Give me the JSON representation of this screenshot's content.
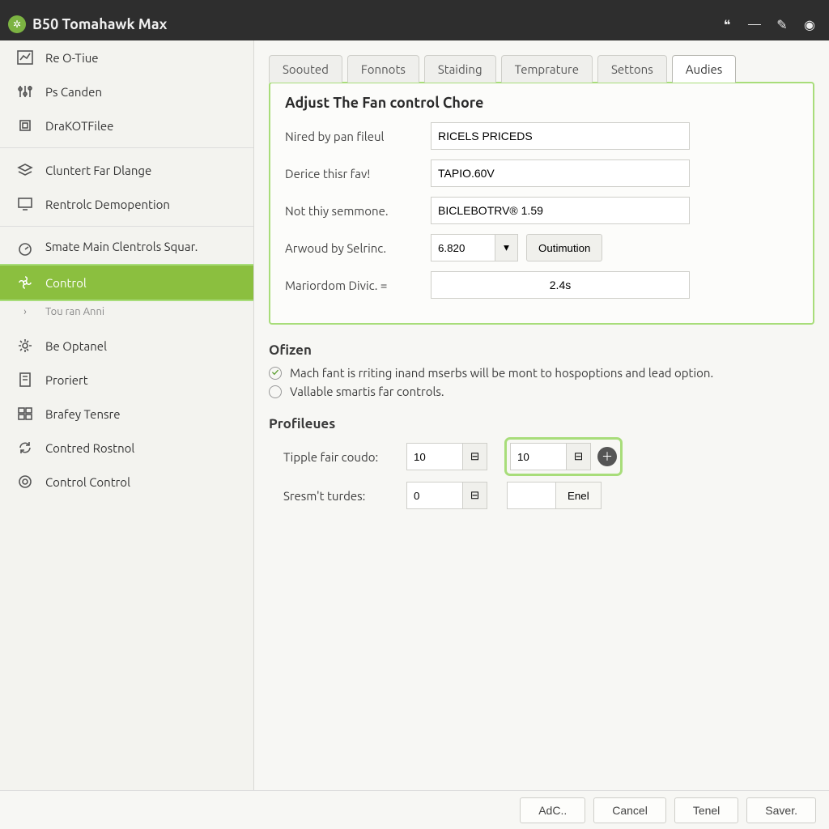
{
  "header": {
    "title": "B50 Tomahawk Max"
  },
  "sidebar": {
    "items": [
      {
        "label": "Re O-Tiue"
      },
      {
        "label": "Ps Canden"
      },
      {
        "label": "DraKOTFilee"
      },
      {
        "label": "Cluntert Far Dlange"
      },
      {
        "label": "Rentrolc Demopention"
      },
      {
        "label": "Smate Main Clentrols Squar."
      },
      {
        "label": "Control"
      },
      {
        "label": "Tou ran Anni"
      },
      {
        "label": "Be Optanel"
      },
      {
        "label": "Proriert"
      },
      {
        "label": "Brafey Tensre"
      },
      {
        "label": "Contred Rostnol"
      },
      {
        "label": "Control Control"
      }
    ]
  },
  "tabs": [
    {
      "label": "Soouted"
    },
    {
      "label": "Fonnots"
    },
    {
      "label": "Staiding"
    },
    {
      "label": "Temprature"
    },
    {
      "label": "Settons"
    },
    {
      "label": "Audies"
    }
  ],
  "panel": {
    "title": "Adjust The Fan control Chore",
    "fields": {
      "f1_label": "Nired by pan fileul",
      "f1_value": "RICELS PRICEDS",
      "f2_label": "Derice thisr fav!",
      "f2_value": "TAPIO.60V",
      "f3_label": "Not thiy semmone.",
      "f3_value": "BICLEBOTRV® 1.59",
      "f4_label": "Arwoud by Selrinc.",
      "f4_value": "6.820",
      "f4_button": "Outimution",
      "f5_label": "Mariordom Divic. =",
      "f5_value": "2.4s"
    }
  },
  "ofizen": {
    "title": "Ofizen",
    "opt1": "Mach fant is rriting inand mserbs will be mont to hospoptions and lead option.",
    "opt2": "Vallable smartis far controls."
  },
  "profiles": {
    "title": "Profileues",
    "row1_label": "Tipple fair coudo:",
    "row1_v1": "10",
    "row1_v2": "10",
    "row2_label": "Sresm't turdes:",
    "row2_v1": "0",
    "row2_btn": "Enel"
  },
  "footer": {
    "b1": "AdC..",
    "b2": "Cancel",
    "b3": "Tenel",
    "b4": "Saver."
  }
}
